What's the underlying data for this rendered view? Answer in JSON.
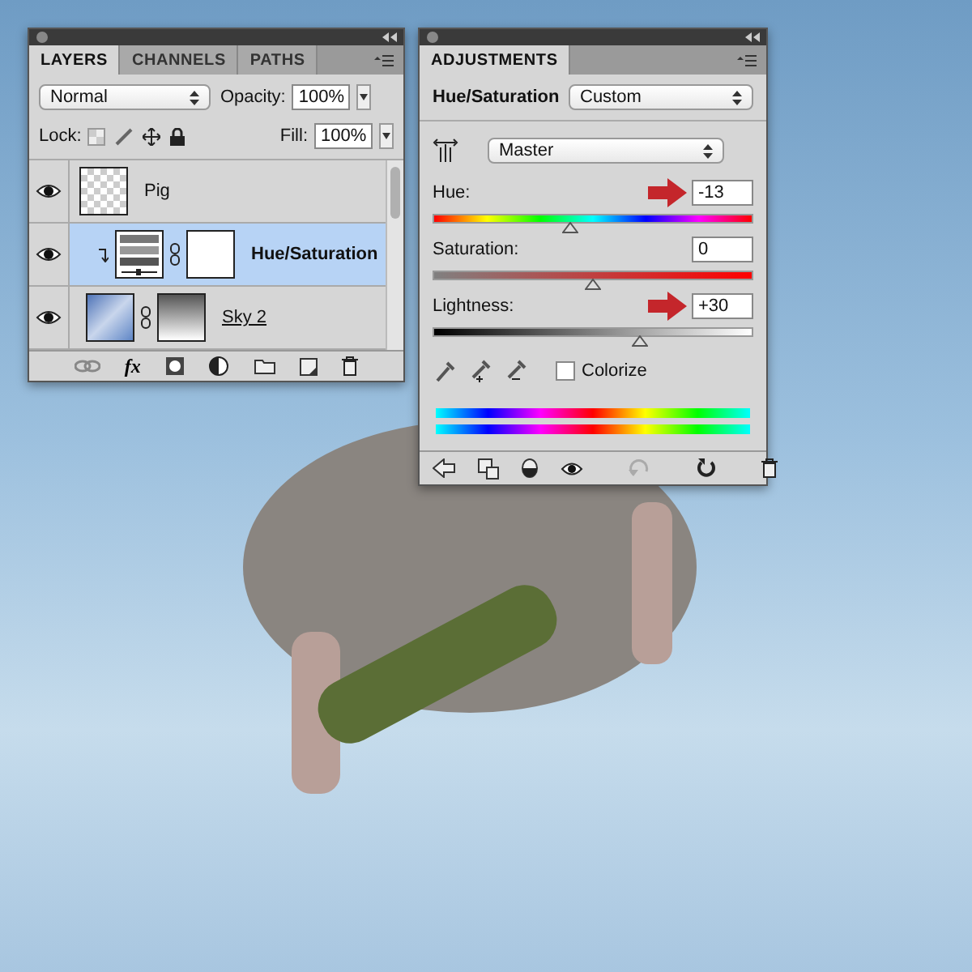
{
  "layers_panel": {
    "tabs": [
      {
        "label": "LAYERS",
        "selected": true
      },
      {
        "label": "CHANNELS",
        "selected": false
      },
      {
        "label": "PATHS",
        "selected": false
      }
    ],
    "blend_mode": "Normal",
    "opacity_label": "Opacity:",
    "opacity": "100%",
    "lock_label": "Lock:",
    "fill_label": "Fill:",
    "fill": "100%",
    "layers": [
      {
        "name": "Pig",
        "kind": "pixel",
        "selected": false,
        "visible": true
      },
      {
        "name": "Hue/Saturation",
        "kind": "adjustment",
        "selected": true,
        "visible": true
      },
      {
        "name": "Sky 2",
        "kind": "masked",
        "selected": false,
        "visible": true
      }
    ],
    "fx": "fx"
  },
  "adjustments_panel": {
    "tab": {
      "label": "ADJUSTMENTS",
      "selected": true
    },
    "title": "Hue/Saturation",
    "preset": "Custom",
    "channel": "Master",
    "sliders": [
      {
        "kind": "hue",
        "label": "Hue:",
        "value": "-13",
        "level": 0.43,
        "highlighted": true
      },
      {
        "kind": "saturation",
        "label": "Saturation:",
        "value": "0",
        "level": 0.5,
        "highlighted": false
      },
      {
        "kind": "lightness",
        "label": "Lightness:",
        "value": "+30",
        "level": 0.65,
        "highlighted": true
      }
    ],
    "colorize": {
      "label": "Colorize",
      "checked": false
    }
  }
}
